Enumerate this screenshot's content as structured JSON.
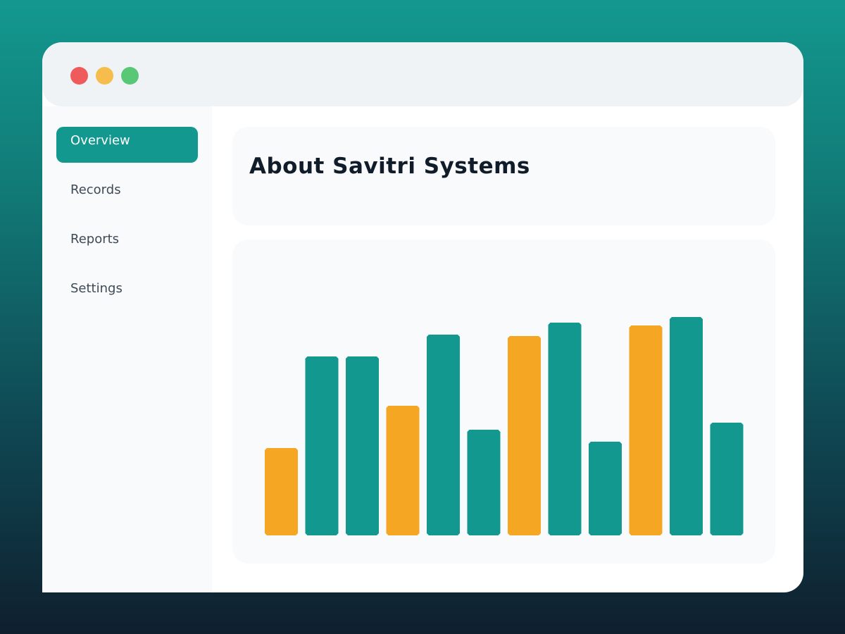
{
  "window": {
    "controls": [
      "close",
      "minimize",
      "maximize"
    ]
  },
  "sidebar": {
    "items": [
      {
        "label": "Overview",
        "active": true
      },
      {
        "label": "Records",
        "active": false
      },
      {
        "label": "Reports",
        "active": false
      },
      {
        "label": "Settings",
        "active": false
      }
    ]
  },
  "main": {
    "title": "About Savitri Systems"
  },
  "colors": {
    "accent": "#13988f",
    "highlight": "#f5a623"
  },
  "chart_data": {
    "type": "bar",
    "categories": [],
    "values": [
      124,
      254,
      254,
      184,
      285,
      150,
      283,
      302,
      133,
      298,
      310,
      160
    ],
    "highlighted": [
      true,
      false,
      false,
      true,
      false,
      false,
      true,
      false,
      false,
      true,
      false,
      false
    ],
    "ylim": [
      0,
      320
    ],
    "grid": false,
    "title": "",
    "xlabel": "",
    "ylabel": ""
  }
}
